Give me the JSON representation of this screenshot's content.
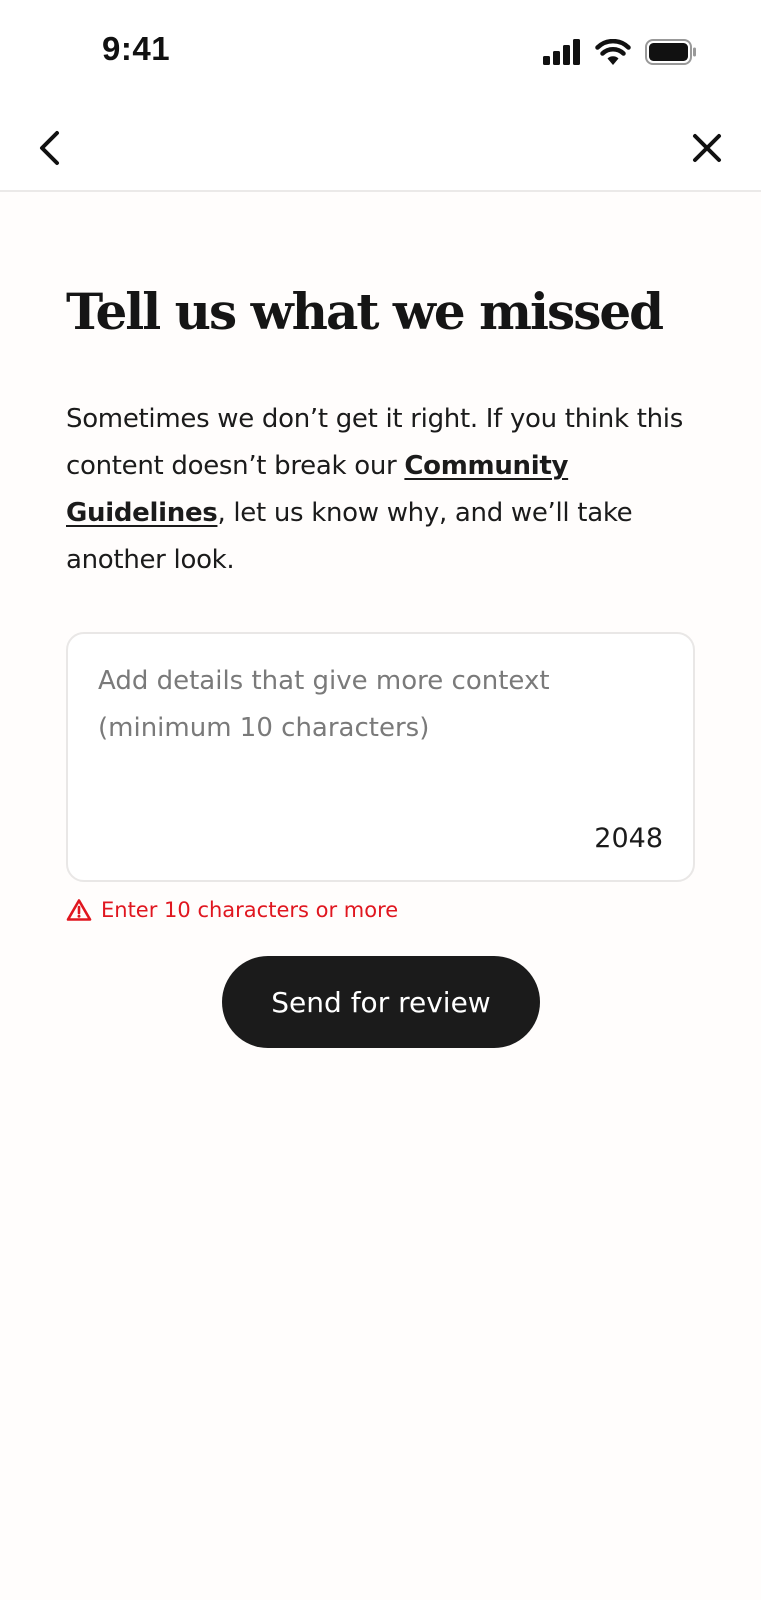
{
  "status_bar": {
    "time": "9:41"
  },
  "nav": {
    "back_icon": "chevron-left-icon",
    "close_icon": "close-icon"
  },
  "page": {
    "title": "Tell us what we missed",
    "description_before": "Sometimes we don’t get it right. If you think this content doesn’t break our ",
    "link_text": "Community Guidelines",
    "description_after": ", let us know why, and we’ll take another look."
  },
  "form": {
    "input_value": "",
    "input_placeholder": "Add details that give more context (minimum 10 characters)",
    "char_count": "2048",
    "error_text": "Enter 10 characters or more",
    "error_icon": "warning-icon",
    "submit_label": "Send for review"
  },
  "colors": {
    "background": "#fffdfc",
    "button": "#1b1b1b",
    "error": "#e0161f",
    "placeholder": "#7a7a7a"
  }
}
